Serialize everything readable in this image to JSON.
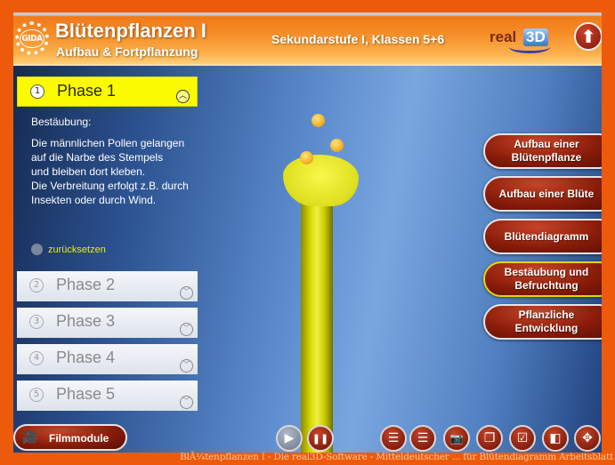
{
  "header": {
    "logo": "GIDA",
    "title": "Blütenpflanzen I",
    "subtitle": "Aufbau & Fortpflanzung",
    "level": "Sekundarstufe I, Klassen 5+6",
    "brand_text": "real",
    "brand_3d": "3D",
    "up_icon": "arrow-up-icon"
  },
  "phases": {
    "active": {
      "number": "1",
      "label": "Phase 1",
      "chevron": "chevron-up-icon",
      "title": "Bestäubung:",
      "description": "Die männlichen Pollen gelangen\nauf die Narbe des Stempels\nund bleiben dort kleben.\nDie Verbreitung erfolgt z.B. durch\nInsekten oder durch Wind."
    },
    "reset_label": "zurücksetzen",
    "items": [
      {
        "number": "2",
        "label": "Phase 2"
      },
      {
        "number": "3",
        "label": "Phase 3"
      },
      {
        "number": "4",
        "label": "Phase 4"
      },
      {
        "number": "5",
        "label": "Phase 5"
      }
    ]
  },
  "nav": {
    "items": [
      {
        "label": "Aufbau einer Blütenpflanze",
        "active": false
      },
      {
        "label": "Aufbau einer Blüte",
        "active": false
      },
      {
        "label": "Blütendiagramm",
        "active": false
      },
      {
        "label": "Bestäubung und Befruchtung",
        "active": true
      },
      {
        "label": "Pflanzliche Entwicklung",
        "active": false
      }
    ],
    "active_color": "#e8d400"
  },
  "footer": {
    "film_label": "Filmmodule",
    "controls": [
      {
        "name": "play-icon",
        "glyph": "▶"
      },
      {
        "name": "pause-icon",
        "glyph": "❚❚"
      }
    ],
    "tools": [
      {
        "name": "list-icon",
        "glyph": "☰"
      },
      {
        "name": "list-alt-icon",
        "glyph": "☰"
      },
      {
        "name": "camera-icon",
        "glyph": "📷"
      },
      {
        "name": "copy-icon",
        "glyph": "❐"
      },
      {
        "name": "checkbox-icon",
        "glyph": "☑"
      },
      {
        "name": "window-icon",
        "glyph": "◧"
      },
      {
        "name": "move-icon",
        "glyph": "✥"
      }
    ]
  },
  "caption": "BlÃ¼tenpflanzen I - Die real3D-Software - Mitteldeutscher ... für Blütendiagramm Arbeitsblatt",
  "colors": {
    "frame": "#ee5a0c",
    "active_phase": "#fcfa00",
    "button_red": "#8a1c0a"
  }
}
